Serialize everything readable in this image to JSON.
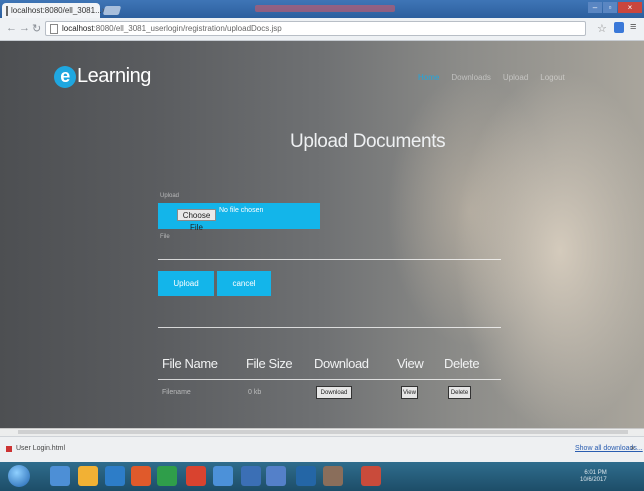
{
  "browser": {
    "tab_title": "localhost:8080/ell_3081...",
    "tab_close": "×",
    "window_controls": [
      "–",
      "▫",
      "×"
    ],
    "url_host": "localhost",
    "url_path": ":8080/ell_3081_userlogin/registration/uploadDocs.jsp",
    "icons": [
      "back-arrow-icon",
      "forward-arrow-icon",
      "reload-icon",
      "star-icon",
      "menu-icon"
    ]
  },
  "site": {
    "logo_letter": "e",
    "logo_text": "Learning",
    "nav": [
      "Home",
      "Downloads",
      "Upload",
      "Logout"
    ]
  },
  "form": {
    "title": "Upload Documents",
    "field_label_top": "Upload",
    "field_label_bottom": "File",
    "choose_button": "Choose File",
    "no_file_text": "No file chosen",
    "upload_button": "Upload",
    "cancel_button": "cancel"
  },
  "table": {
    "headers": [
      "File Name",
      "File Size",
      "Download",
      "View",
      "Delete"
    ],
    "row": {
      "file_name": "Filename",
      "file_size": "0 kb",
      "download": "Download",
      "view": "View",
      "delete": "Delete"
    }
  },
  "downloads": {
    "item": "User Login.html",
    "show_all": "Show all downloads...",
    "close": "×"
  },
  "taskbar": {
    "time": "6:01 PM",
    "date": "10/6/2017",
    "icon_colors": [
      "#4d8fd6",
      "#f2b134",
      "#2d7dc8",
      "#e05a2b",
      "#2f9e4a",
      "#d9432f",
      "#4c91d9",
      "#3b6fb5",
      "#5480c9",
      "#2466a6",
      "#8a6e5b",
      "#c94b3b"
    ]
  },
  "colors": {
    "accent": "#13b5ea"
  }
}
